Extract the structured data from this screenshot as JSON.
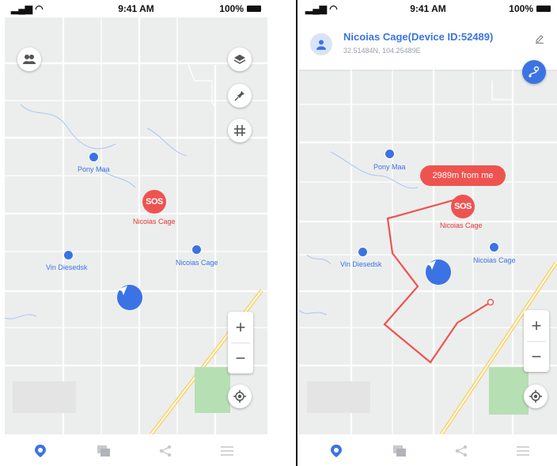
{
  "status_bar": {
    "time": "9:41 AM",
    "battery": "100%"
  },
  "screen_left": {
    "people": [
      {
        "name": "Pony Maa",
        "color": "#3b73e4"
      },
      {
        "name": "Vin Diesedsk",
        "color": "#3b73e4"
      },
      {
        "name": "Nicoias Cage",
        "color": "#3b73e4"
      }
    ],
    "sos": {
      "badge": "SOS",
      "name": "Nicoias Cage"
    }
  },
  "screen_right": {
    "device_title": "Nicoias Cage(Device ID:52489)",
    "device_coords": "32.51484N, 104.25489E",
    "distance_bubble": "2989m from me",
    "people": [
      {
        "name": "Pony Maa"
      },
      {
        "name": "Vin Diesedsk"
      },
      {
        "name": "Nicoias Cage"
      }
    ],
    "sos": {
      "badge": "SOS",
      "name": "Nicoias Cage"
    },
    "route_color": "#ef5350"
  },
  "zoom": {
    "plus": "+",
    "minus": "−"
  },
  "icons": {
    "map_controls": [
      "group-icon",
      "layers-icon",
      "pin-icon",
      "grid-icon"
    ],
    "tabs": [
      "location-tab-icon",
      "messages-tab-icon",
      "share-tab-icon",
      "menu-tab-icon"
    ]
  },
  "colors": {
    "accent": "#3b73e4",
    "sos": "#ef5350",
    "map_bg": "#eceeed"
  }
}
